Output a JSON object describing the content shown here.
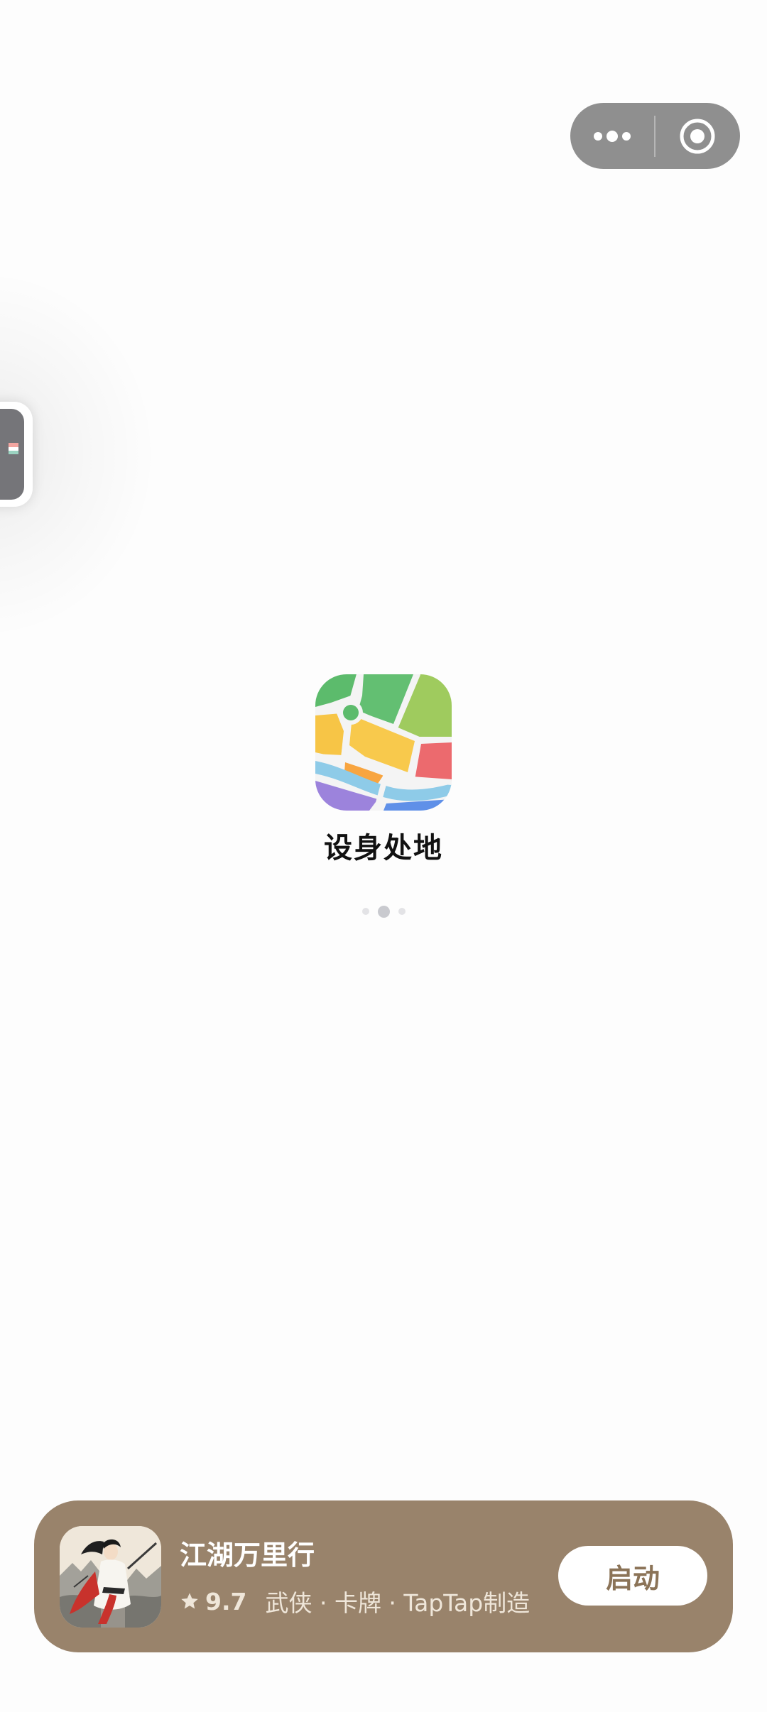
{
  "colors": {
    "background": "#fdfdfd",
    "capsule": "#8f8f8f",
    "banner": "#99836b",
    "launch_text": "#8b7357"
  },
  "capsule": {
    "more_icon": "more-dots-icon",
    "close_icon": "target-circle-icon"
  },
  "edge_widget": {
    "icon": "floating-window-icon"
  },
  "app": {
    "icon": "map-app-icon",
    "name": "设身处地"
  },
  "loading": {
    "dots": 3,
    "active_index": 1
  },
  "promo": {
    "thumbnail": "wuxia-swordsman-thumbnail",
    "title": "江湖万里行",
    "star_icon": "star-icon",
    "rating": "9.7",
    "tags": "武侠 · 卡牌 · TapTap制造",
    "button_label": "启动"
  }
}
